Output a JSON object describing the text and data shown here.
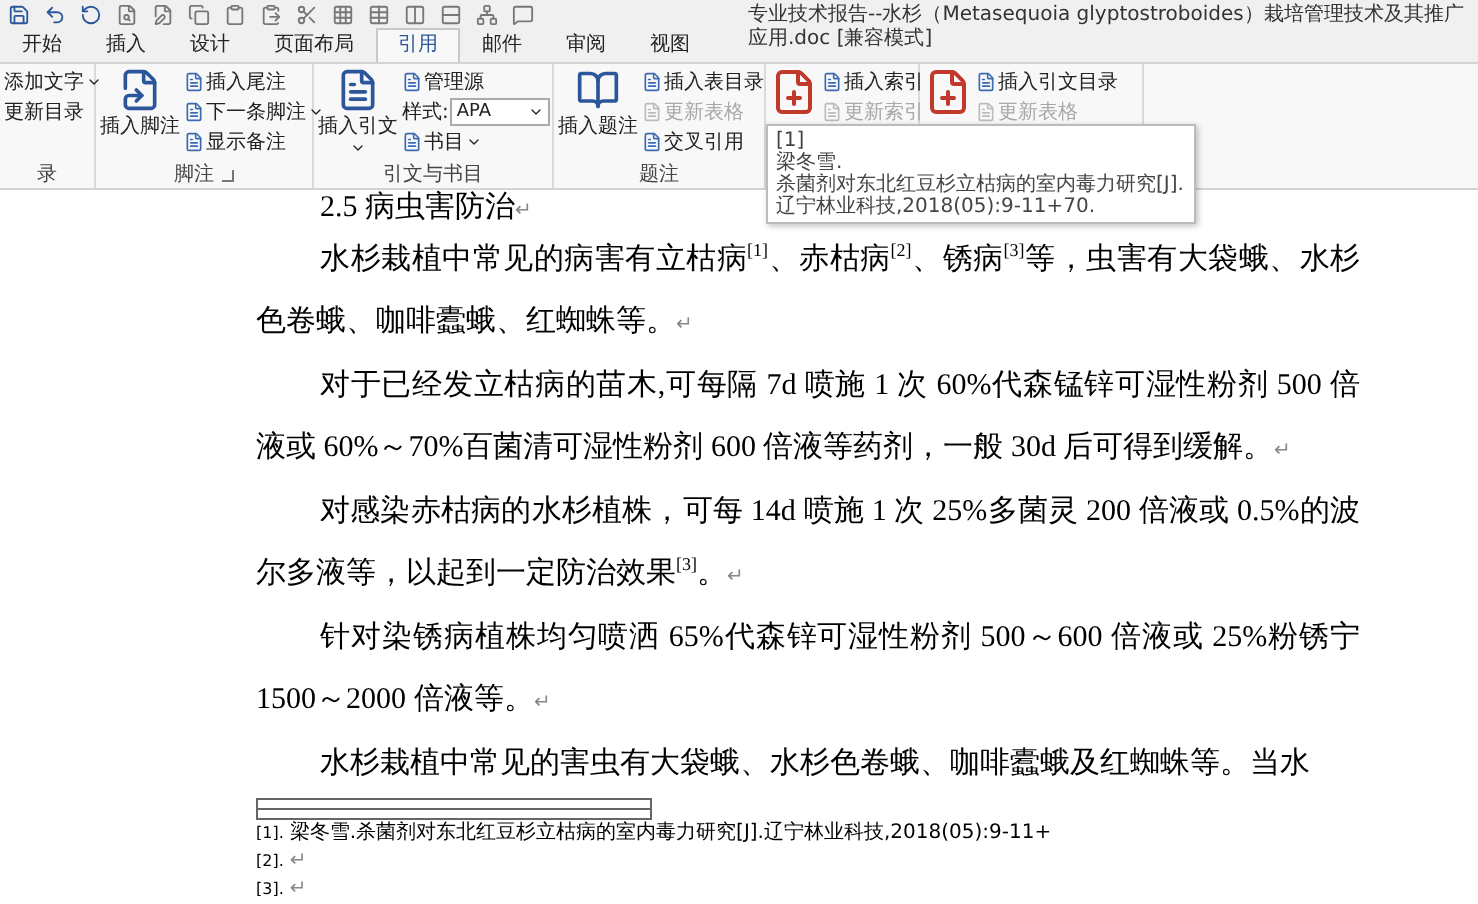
{
  "title": "专业技术报告--水杉（Metasequoia glyptostroboides）栽培管理技术及其推广应用.doc [兼容模式]",
  "tabs": [
    {
      "label": "开始",
      "selected": false
    },
    {
      "label": "插入",
      "selected": false
    },
    {
      "label": "设计",
      "selected": false
    },
    {
      "label": "页面布局",
      "selected": false
    },
    {
      "label": "引用",
      "selected": true
    },
    {
      "label": "邮件",
      "selected": false
    },
    {
      "label": "审阅",
      "selected": false
    },
    {
      "label": "视图",
      "selected": false
    }
  ],
  "ribbon": {
    "groups": [
      {
        "label": "录",
        "items": [
          {
            "kind": "text",
            "label": "添加文字",
            "dropdown": true,
            "disabled": false
          },
          {
            "kind": "text",
            "label": "更新目录",
            "disabled": false
          }
        ]
      },
      {
        "label": "脚注",
        "launcher": true,
        "items": [
          {
            "kind": "large",
            "label": "插入脚注",
            "disabled": false
          },
          {
            "kind": "small",
            "label": "插入尾注",
            "disabled": false
          },
          {
            "kind": "small",
            "label": "下一条脚注",
            "dropdown": true,
            "disabled": false
          },
          {
            "kind": "small",
            "label": "显示备注",
            "disabled": false
          }
        ]
      },
      {
        "label": "引文与书目",
        "items": [
          {
            "kind": "large",
            "label": "插入引文",
            "dropdown": true,
            "disabled": false
          },
          {
            "kind": "small",
            "label": "管理源",
            "disabled": false
          },
          {
            "kind": "style",
            "label": "样式:",
            "value": "APA",
            "dropdown": true,
            "disabled": false
          },
          {
            "kind": "small",
            "label": "书目",
            "dropdown": true,
            "disabled": false
          }
        ]
      },
      {
        "label": "题注",
        "items": [
          {
            "kind": "large",
            "label": "插入题注",
            "disabled": false
          },
          {
            "kind": "small",
            "label": "插入表目录",
            "disabled": false
          },
          {
            "kind": "small",
            "label": "更新表格",
            "disabled": true
          },
          {
            "kind": "small",
            "label": "交叉引用",
            "disabled": false
          }
        ]
      },
      {
        "items": [
          {
            "kind": "icon",
            "disabled": false
          },
          {
            "kind": "small",
            "label": "插入索引",
            "disabled": false
          },
          {
            "kind": "small",
            "label": "更新索引",
            "disabled": true
          }
        ]
      },
      {
        "items": [
          {
            "kind": "icon",
            "disabled": false
          },
          {
            "kind": "small",
            "label": "插入引文目录",
            "disabled": false
          },
          {
            "kind": "small",
            "label": "更新表格",
            "disabled": true
          }
        ]
      }
    ]
  },
  "tooltip": {
    "lines": [
      "[1]",
      "梁冬雪.",
      "杀菌剂对东北红豆杉立枯病的室内毒力研究[J].辽宁林业科技,2018(05):9-11+70."
    ]
  },
  "document": {
    "heading": "2.5 病虫害防治",
    "heading_mark": "↵",
    "paragraphs": [
      {
        "text": "水杉栽植中常见的病害有立枯病$^{[1]}$、赤枯病$^{[2]}$、锈病$^{[3]}$等，虫害有大袋蛾、水杉色卷蛾、咖啡蠹蛾、红蜘蛛等。",
        "end_mark": "↵"
      },
      {
        "text": "对于已经发立枯病的苗木,可每隔 7d 喷施 1 次 60%代森锰锌可湿性粉剂 500 倍液或 60%～70%百菌清可湿性粉剂 600 倍液等药剂，一般 30d 后可得到缓解。",
        "end_mark": "↵"
      },
      {
        "text": "对感染赤枯病的水杉植株，可每 14d 喷施 1 次 25%多菌灵 200 倍液或 0.5%的波尔多液等，以起到一定防治效果$^{[3]}$。",
        "end_mark": "↵"
      },
      {
        "text": "针对染锈病植株均匀喷洒 65%代森锌可湿性粉剂 500～600 倍液或 25%粉锈宁 1500～2000 倍液等。",
        "end_mark": "↵"
      },
      {
        "text": "水杉栽植中常见的害虫有大袋蛾、水杉色卷蛾、咖啡蠹蛾及红蜘蛛等。当水"
      }
    ],
    "footnotes": [
      {
        "mark": "[1].",
        "text": "梁冬雪.杀菌剂对东北红豆杉立枯病的室内毒力研究[J].辽宁林业科技,2018(05):9-11+"
      },
      {
        "mark": "[2].",
        "end_mark": "↵"
      },
      {
        "mark": "[3].",
        "end_mark": "↵"
      }
    ]
  }
}
